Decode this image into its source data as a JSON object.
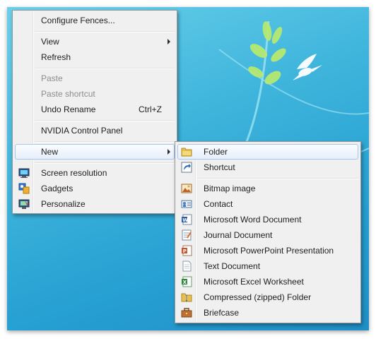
{
  "context_menu": {
    "configure_fences": "Configure Fences...",
    "view": "View",
    "refresh": "Refresh",
    "paste": "Paste",
    "paste_shortcut": "Paste shortcut",
    "undo_rename": "Undo Rename",
    "undo_rename_shortcut": "Ctrl+Z",
    "nvidia": "NVIDIA Control Panel",
    "new": "New",
    "screen_resolution": "Screen resolution",
    "gadgets": "Gadgets",
    "personalize": "Personalize"
  },
  "new_submenu": {
    "items": [
      {
        "label": "Folder",
        "icon": "folder-icon"
      },
      {
        "label": "Shortcut",
        "icon": "shortcut-icon"
      },
      {
        "label": "Bitmap image",
        "icon": "bitmap-icon"
      },
      {
        "label": "Contact",
        "icon": "contact-icon"
      },
      {
        "label": "Microsoft Word Document",
        "icon": "word-document-icon"
      },
      {
        "label": "Journal Document",
        "icon": "journal-document-icon"
      },
      {
        "label": "Microsoft PowerPoint Presentation",
        "icon": "powerpoint-icon"
      },
      {
        "label": "Text Document",
        "icon": "text-document-icon"
      },
      {
        "label": "Microsoft Excel Worksheet",
        "icon": "excel-icon"
      },
      {
        "label": "Compressed (zipped) Folder",
        "icon": "zip-folder-icon"
      },
      {
        "label": "Briefcase",
        "icon": "briefcase-icon"
      }
    ]
  },
  "colors": {
    "menu_bg": "#f0f0f0",
    "highlight_border": "#a8c7ec",
    "disabled_text": "#8d8d8d",
    "desktop_blue": "#3fb5dc"
  }
}
